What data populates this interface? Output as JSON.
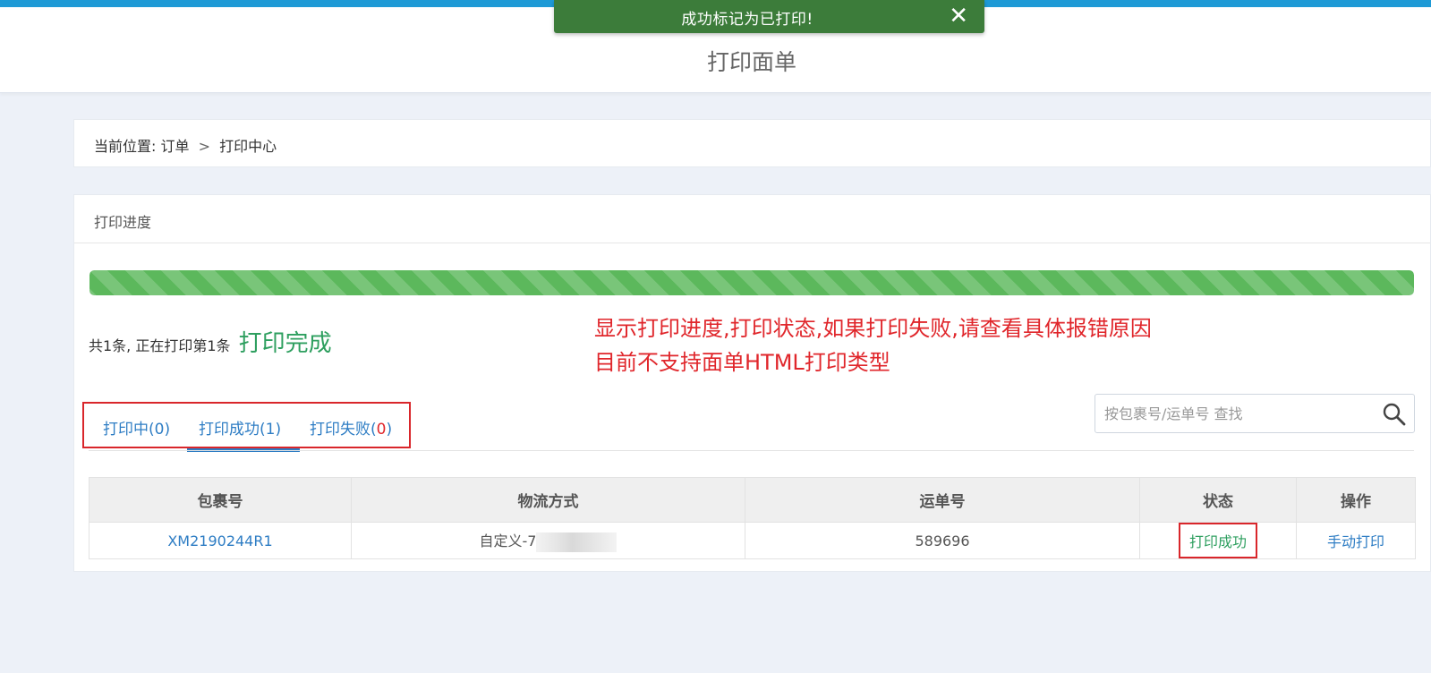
{
  "header": {
    "title": "打印面单"
  },
  "toast": {
    "message": "成功标记为已打印!",
    "close_label": "✕"
  },
  "breadcrumb": {
    "prefix": "当前位置:",
    "level1": "订单",
    "separator": ">",
    "level2": "打印中心"
  },
  "progress_panel": {
    "title": "打印进度",
    "progress_fraction": 1.0,
    "summary_text": "共1条, 正在打印第1条",
    "status_text": "打印完成"
  },
  "annotation": {
    "line1": "显示打印进度,打印状态,如果打印失败,请查看具体报错原因",
    "line2": "目前不支持面单HTML打印类型"
  },
  "tabs": [
    {
      "label": "打印中(0)",
      "active": false
    },
    {
      "label": "打印成功(1)",
      "active": true
    },
    {
      "label_prefix": "打印失败(",
      "count": "0",
      "label_suffix": ")",
      "active": false
    }
  ],
  "search": {
    "placeholder": "按包裹号/运单号 查找",
    "value": ""
  },
  "table": {
    "columns": [
      "包裹号",
      "物流方式",
      "运单号",
      "状态",
      "操作"
    ],
    "rows": [
      {
        "package_no": "XM2190244R1",
        "shipping_method": "自定义-7",
        "tracking_no": "589696",
        "status": "打印成功",
        "action": "手动打印"
      }
    ]
  },
  "colors": {
    "accent": "#1e9ad6",
    "toast_bg": "#3c7c3a",
    "progress": "#5cb85c",
    "success_text": "#2e9f5f",
    "link": "#2e7dc4",
    "annotation": "#e0262b"
  }
}
